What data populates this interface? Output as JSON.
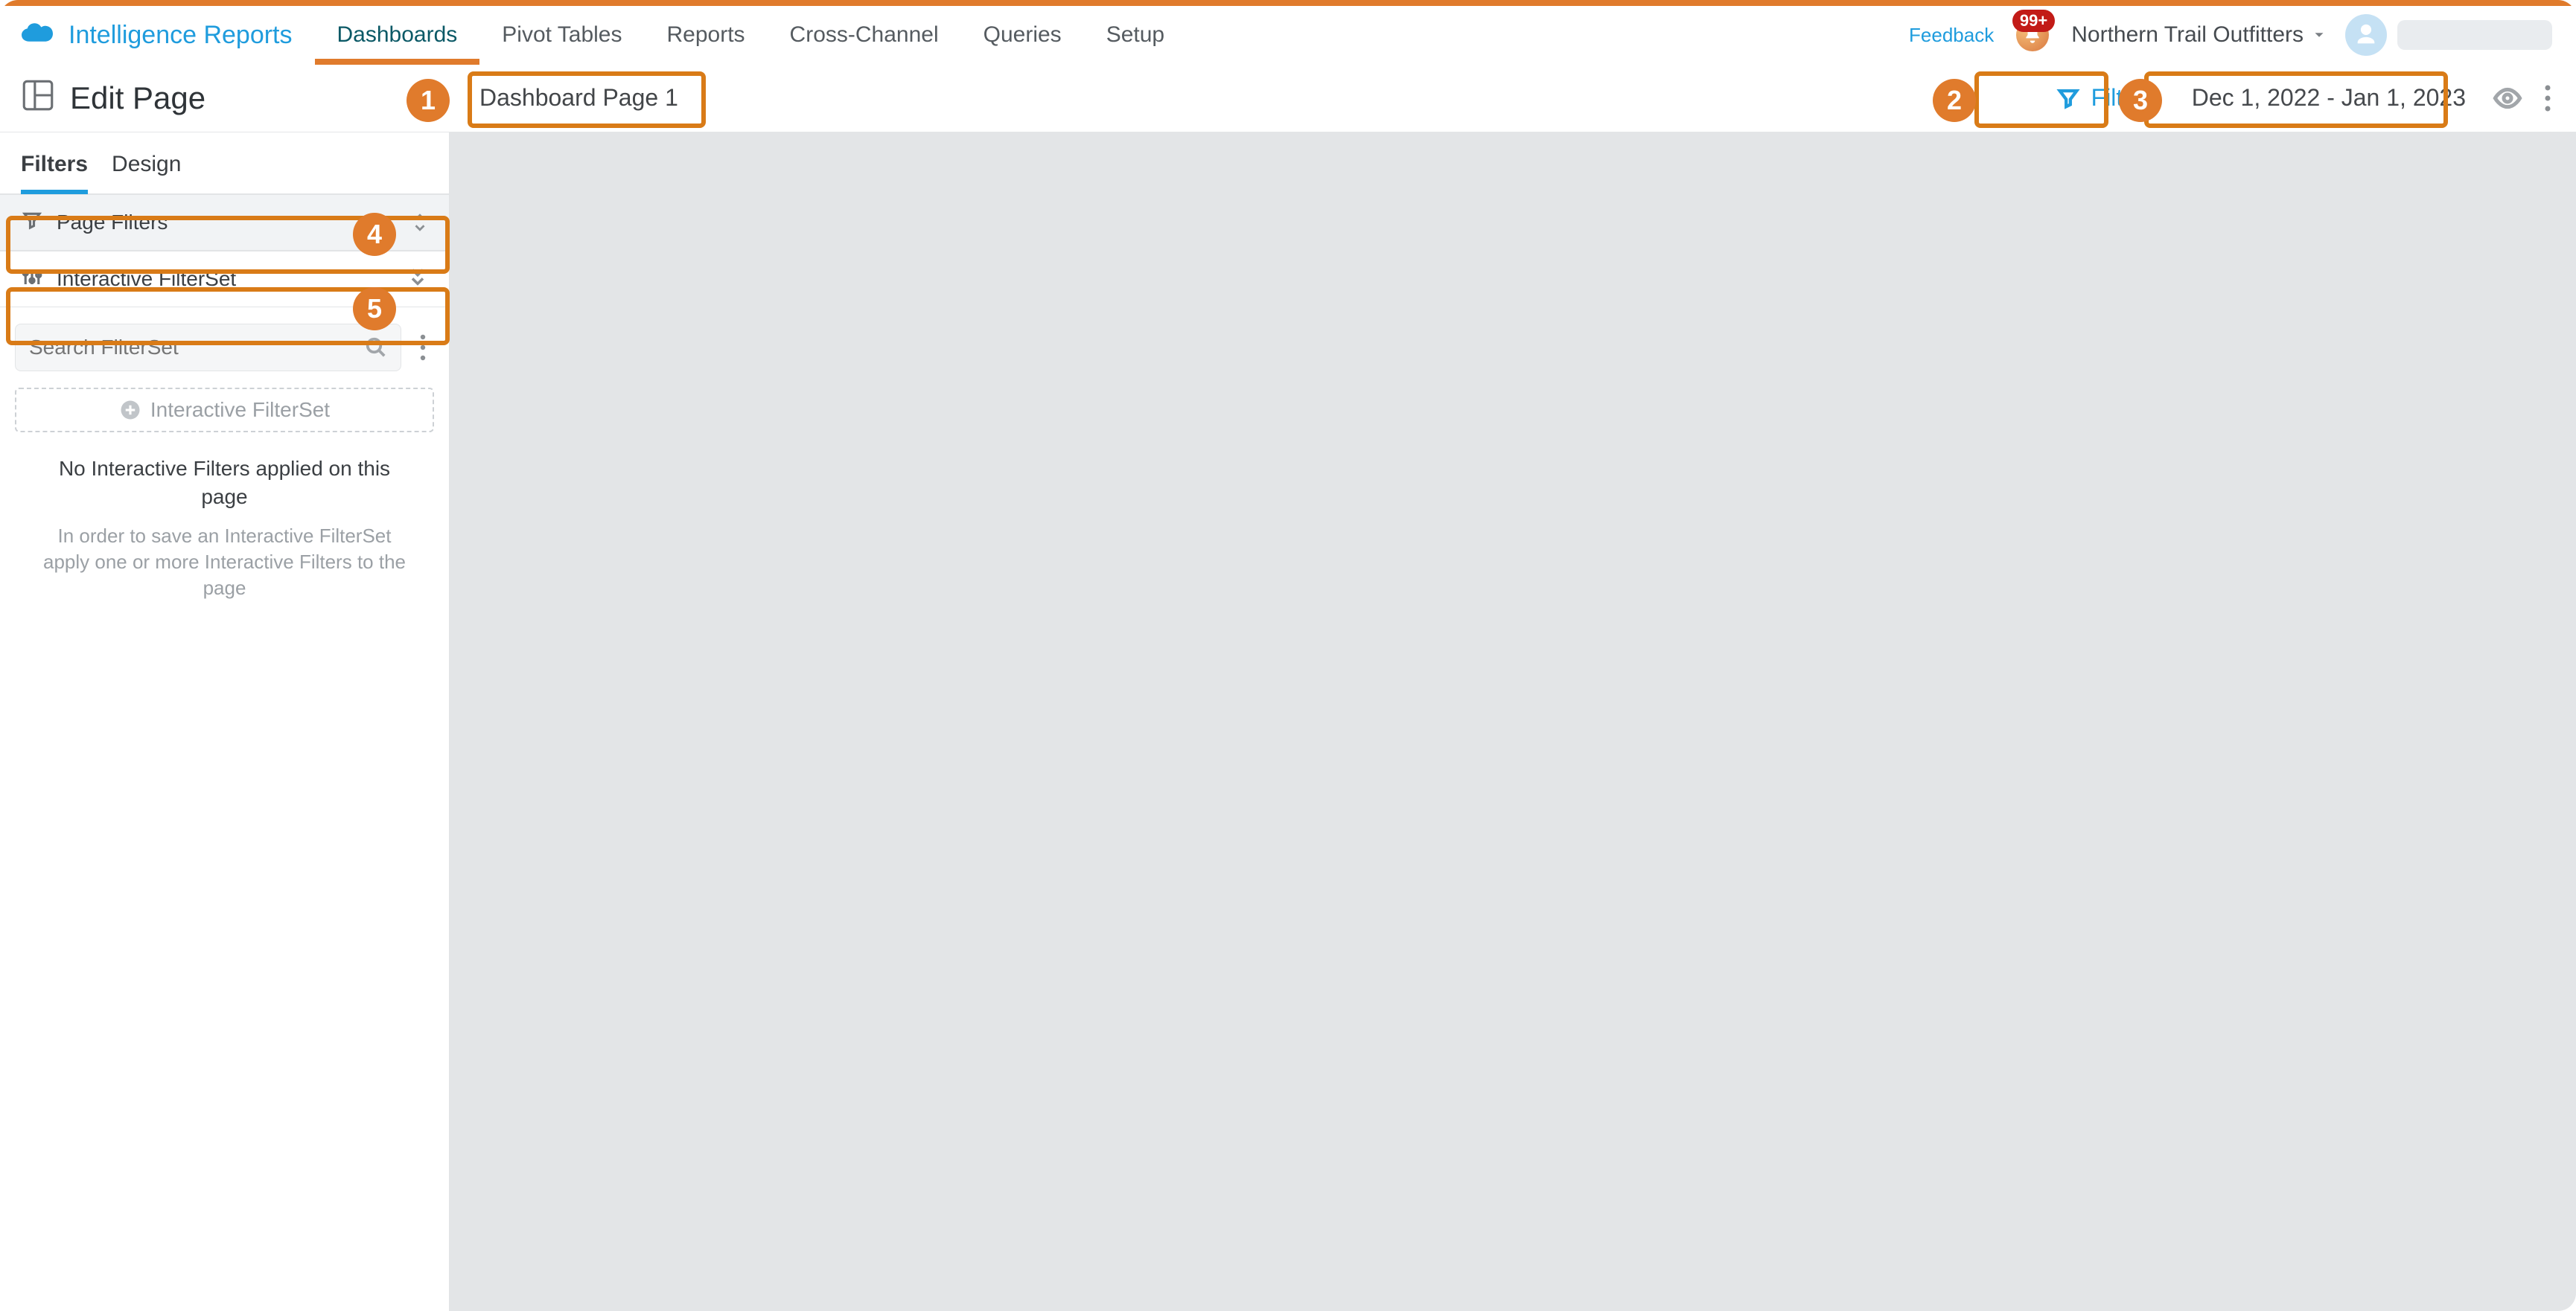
{
  "brand": {
    "name": "Intelligence Reports"
  },
  "nav": {
    "items": [
      {
        "label": "Dashboards",
        "active": true
      },
      {
        "label": "Pivot Tables"
      },
      {
        "label": "Reports"
      },
      {
        "label": "Cross-Channel"
      },
      {
        "label": "Queries"
      },
      {
        "label": "Setup"
      }
    ]
  },
  "top": {
    "feedback": "Feedback",
    "notif_count": "99+",
    "org": "Northern Trail Outfitters"
  },
  "page": {
    "edit_title": "Edit Page",
    "title": "Dashboard Page 1",
    "filters_btn": "Filters",
    "date_range": "Dec 1, 2022 - Jan 1, 2023"
  },
  "side": {
    "tabs": {
      "filters": "Filters",
      "design": "Design",
      "active": "filters"
    },
    "page_filters_label": "Page Filters",
    "interactive_filterset_label": "Interactive FilterSet",
    "search_placeholder": "Search FilterSet",
    "add_filterset_label": "Interactive FilterSet",
    "empty_head": "No Interactive Filters applied on this page",
    "empty_sub": "In order to save an Interactive FilterSet apply one or more Interactive Filters to the page"
  },
  "annotations": {
    "1": "1",
    "2": "2",
    "3": "3",
    "4": "4",
    "5": "5"
  }
}
